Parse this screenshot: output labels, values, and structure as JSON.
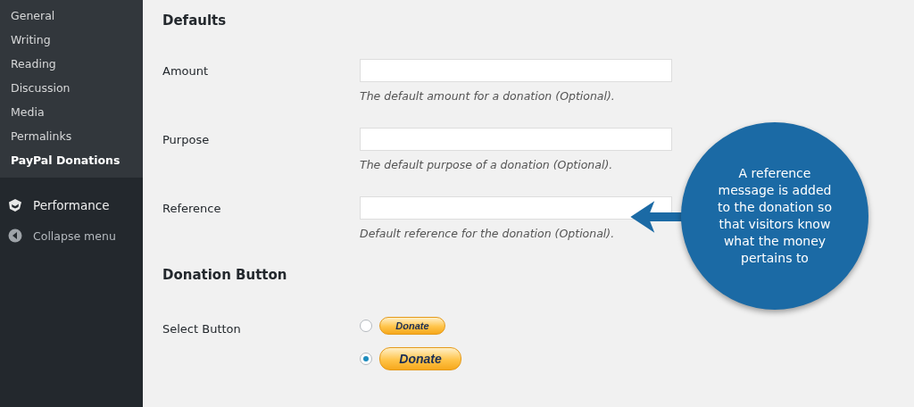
{
  "sidebar": {
    "submenu": [
      {
        "label": "General",
        "selected": false
      },
      {
        "label": "Writing",
        "selected": false
      },
      {
        "label": "Reading",
        "selected": false
      },
      {
        "label": "Discussion",
        "selected": false
      },
      {
        "label": "Media",
        "selected": false
      },
      {
        "label": "Permalinks",
        "selected": false
      },
      {
        "label": "PayPal Donations",
        "selected": true
      }
    ],
    "menu": [
      {
        "label": "Performance",
        "kind": "performance"
      },
      {
        "label": "Collapse menu",
        "kind": "collapse"
      }
    ]
  },
  "sections": [
    {
      "title": "Defaults",
      "fields": [
        {
          "label": "Amount",
          "hint": "The default amount for a donation (Optional)."
        },
        {
          "label": "Purpose",
          "hint": "The default purpose of a donation (Optional)."
        },
        {
          "label": "Reference",
          "hint": "Default reference for the donation (Optional)."
        }
      ]
    },
    {
      "title": "Donation Button",
      "select": {
        "label": "Select Button",
        "options": [
          {
            "button": "Donate",
            "kind": "small",
            "selected": false
          },
          {
            "button": "Donate",
            "kind": "large",
            "selected": true
          }
        ]
      }
    }
  ],
  "callout": {
    "text": "A reference message is added to the donation so that visitors know what the money pertains to"
  }
}
